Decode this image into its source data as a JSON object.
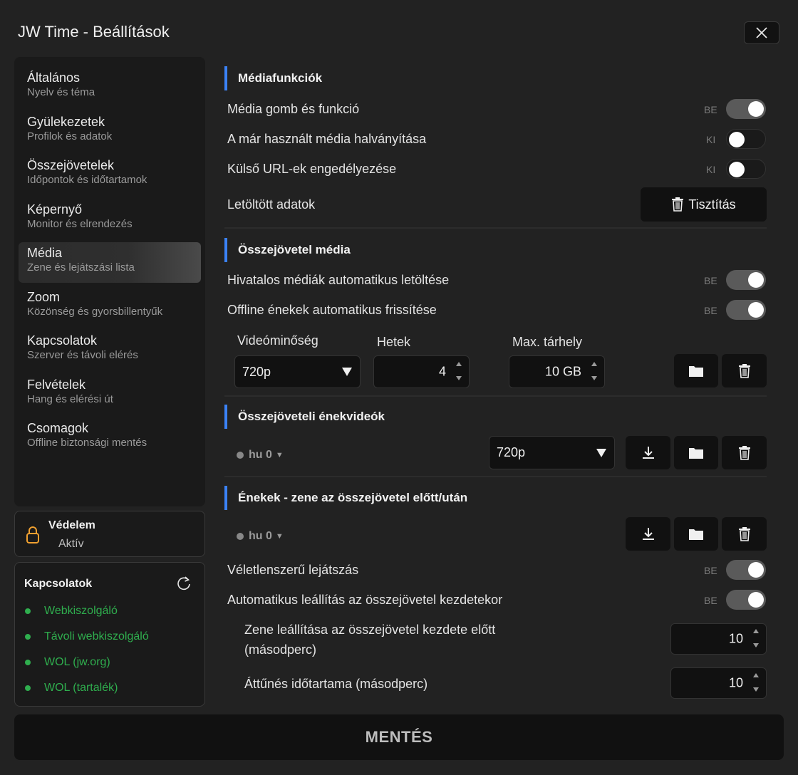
{
  "window": {
    "title": "JW Time - Beállítások"
  },
  "sidebar": {
    "items": [
      {
        "label": "Általános",
        "sub": "Nyelv és téma"
      },
      {
        "label": "Gyülekezetek",
        "sub": "Profilok és adatok"
      },
      {
        "label": "Összejövetelek",
        "sub": "Időpontok és időtartamok"
      },
      {
        "label": "Képernyő",
        "sub": "Monitor és elrendezés"
      },
      {
        "label": "Média",
        "sub": "Zene és lejátszási lista"
      },
      {
        "label": "Zoom",
        "sub": "Közönség és gyorsbillentyűk"
      },
      {
        "label": "Kapcsolatok",
        "sub": "Szerver és távoli elérés"
      },
      {
        "label": "Felvételek",
        "sub": "Hang és elérési út"
      },
      {
        "label": "Csomagok",
        "sub": "Offline biztonsági mentés"
      }
    ],
    "active_index": 4
  },
  "protection": {
    "title": "Védelem",
    "status": "Aktív"
  },
  "connections": {
    "title": "Kapcsolatok",
    "items": [
      "Webkiszolgáló",
      "Távoli webkiszolgáló",
      "WOL (jw.org)",
      "WOL (tartalék)"
    ],
    "status_color": "#2fae4e"
  },
  "sections": {
    "media_functions": {
      "title": "Médiafunkciók",
      "media_button": {
        "label": "Média gomb és funkció",
        "state": "BE"
      },
      "dim_used": {
        "label": "A már használt média halványítása",
        "state": "KI"
      },
      "external_urls": {
        "label": "Külső URL-ek engedélyezése",
        "state": "KI"
      },
      "downloaded": {
        "label": "Letöltött adatok",
        "button": "Tisztítás"
      }
    },
    "meeting_media": {
      "title": "Összejövetel média",
      "auto_download": {
        "label": "Hivatalos médiák automatikus letöltése",
        "state": "BE"
      },
      "auto_refresh": {
        "label": "Offline énekek automatikus frissítése",
        "state": "BE"
      },
      "video_quality": {
        "label": "Videóminőség",
        "value": "720p"
      },
      "weeks": {
        "label": "Hetek",
        "value": "4"
      },
      "max_storage": {
        "label": "Max. tárhely",
        "value": "10 GB"
      }
    },
    "song_videos": {
      "title": "Összejöveteli énekvideók",
      "lang": "hu 0",
      "quality": "720p"
    },
    "songs_music": {
      "title": "Énekek - zene az összejövetel előtt/után",
      "lang": "hu 0",
      "shuffle": {
        "label": "Véletlenszerű lejátszás",
        "state": "BE"
      },
      "auto_stop": {
        "label": "Automatikus leállítás az összejövetel kezdetekor",
        "state": "BE"
      },
      "stop_before": {
        "label_line1": "Zene leállítása az összejövetel kezdete előtt",
        "label_line2": "(másodperc)",
        "value": "10"
      },
      "fade": {
        "label": "Áttűnés időtartama (másodperc)",
        "value": "10"
      }
    }
  },
  "footer": {
    "save_label": "MENTÉS"
  },
  "colors": {
    "accent": "#3b82f6",
    "background": "#222222",
    "panel": "#1a1a1a"
  }
}
